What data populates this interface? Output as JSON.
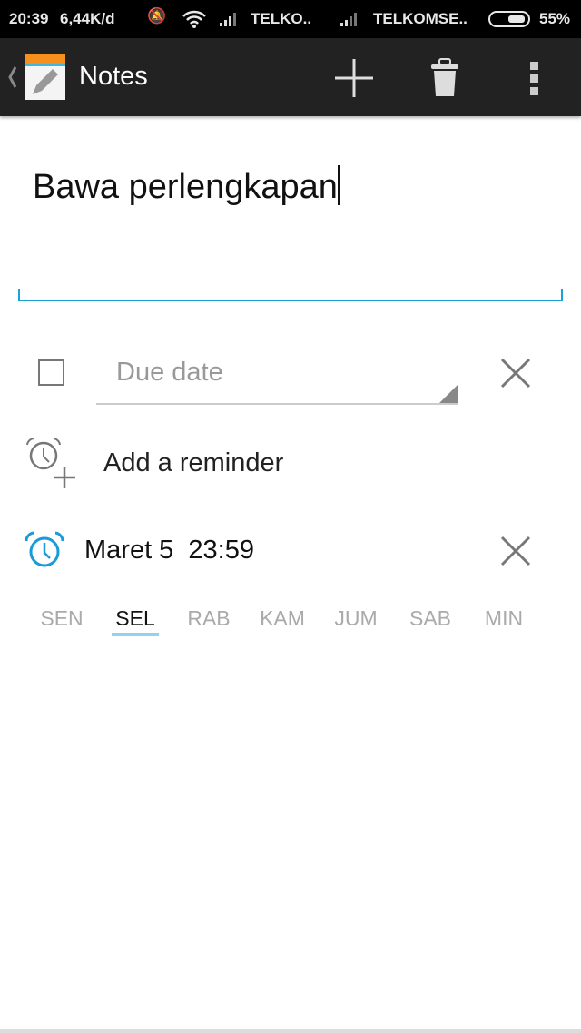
{
  "status_bar": {
    "time": "20:39",
    "speed": "6,44K/d",
    "carrier1": "TELKO..",
    "carrier2": "TELKOMSE..",
    "battery": "55%",
    "battery_level": 55
  },
  "app_bar": {
    "title": "Notes",
    "icons": [
      "back-chevron-icon",
      "notes-app-icon",
      "add-icon",
      "trash-icon",
      "overflow-menu-icon"
    ]
  },
  "note": {
    "text": "Bawa perlengkapan"
  },
  "due_date": {
    "placeholder": "Due date",
    "checked": false
  },
  "add_reminder": {
    "label": "Add a reminder"
  },
  "reminder": {
    "value": "Maret 5  23:59",
    "accent": "#1a9ad6"
  },
  "days": [
    {
      "label": "SEN",
      "selected": false
    },
    {
      "label": "SEL",
      "selected": true
    },
    {
      "label": "RAB",
      "selected": false
    },
    {
      "label": "KAM",
      "selected": false
    },
    {
      "label": "JUM",
      "selected": false
    },
    {
      "label": "SAB",
      "selected": false
    },
    {
      "label": "MIN",
      "selected": false
    }
  ]
}
